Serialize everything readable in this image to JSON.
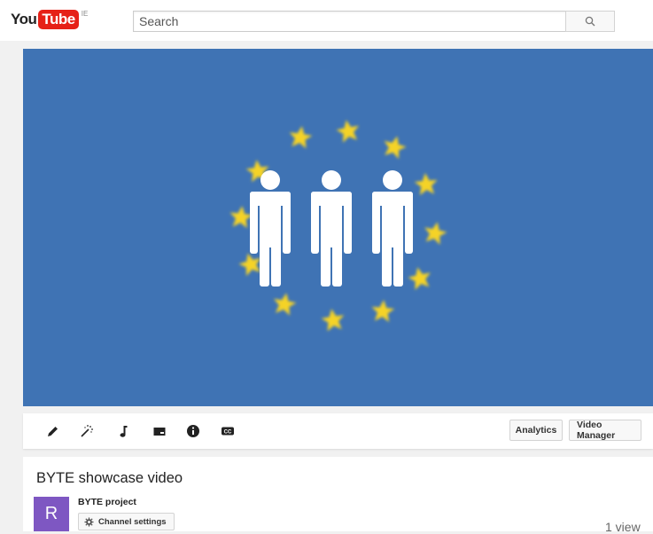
{
  "header": {
    "logo_you": "You",
    "logo_tube": "Tube",
    "logo_region": "IE",
    "search_placeholder": "Search",
    "search_icon": "search-icon"
  },
  "player": {
    "background_color": "#3f73b4",
    "star_color": "#f5d327",
    "figure_color": "#ffffff"
  },
  "toolbar": {
    "tools": [
      {
        "name": "enhance",
        "icon": "pencil-icon"
      },
      {
        "name": "effects",
        "icon": "magic-wand-icon"
      },
      {
        "name": "audio",
        "icon": "music-note-icon"
      },
      {
        "name": "annotations",
        "icon": "annotation-icon"
      },
      {
        "name": "info",
        "icon": "info-icon"
      },
      {
        "name": "subtitles",
        "icon": "cc-icon"
      }
    ],
    "analytics_label": "Analytics",
    "video_manager_label": "Video Manager"
  },
  "info": {
    "title": "BYTE showcase video",
    "avatar_letter": "R",
    "avatar_color": "#7e57c2",
    "channel_name": "BYTE project",
    "channel_settings_label": "Channel settings",
    "view_count": "1 view"
  }
}
